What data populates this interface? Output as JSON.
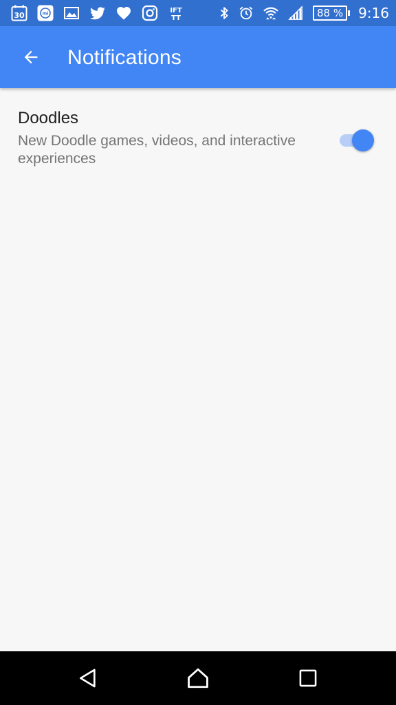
{
  "status_bar": {
    "calendar_day": "30",
    "fitness_app_text": "mi",
    "ifttt_text": "IFTTT",
    "battery_text": "88 %",
    "time": "9:16",
    "left_icons": [
      "calendar-icon",
      "mi-fit-icon",
      "image-icon",
      "twitter-icon",
      "heart-icon",
      "instagram-icon",
      "ifttt-icon"
    ],
    "right_icons": [
      "bluetooth-icon",
      "alarm-icon",
      "wifi-icon",
      "signal-icon",
      "battery-icon"
    ]
  },
  "app_bar": {
    "title": "Notifications",
    "back_icon": "arrow-back-icon",
    "background_color": "#4285f4"
  },
  "settings": [
    {
      "title": "Doodles",
      "summary": "New Doodle games, videos, and interactive experiences",
      "enabled": true
    }
  ],
  "colors": {
    "accent": "#4285f4",
    "status_bar": "#3270d0",
    "toggle_track": "#b6cef8",
    "background": "#f7f7f7"
  },
  "nav_bar": {
    "buttons": [
      "back-triangle-icon",
      "home-icon",
      "recents-icon"
    ]
  }
}
